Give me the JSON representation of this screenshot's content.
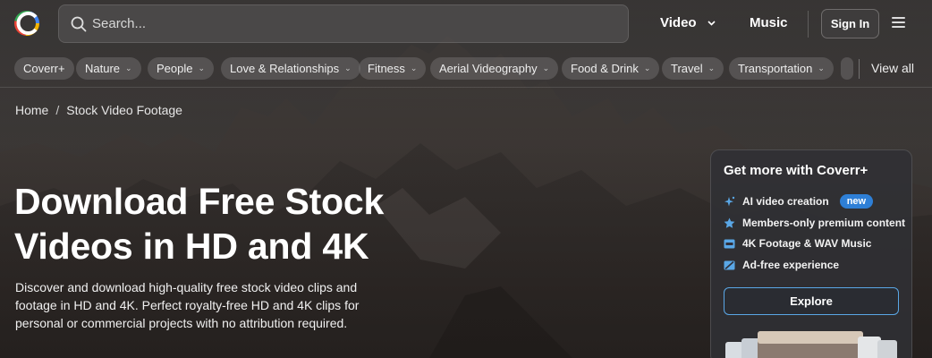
{
  "header": {
    "search_placeholder": "Search...",
    "nav_video": "Video",
    "nav_music": "Music",
    "signin": "Sign In"
  },
  "categories": [
    {
      "label": "Coverr+",
      "has_dropdown": false
    },
    {
      "label": "Nature",
      "has_dropdown": true
    },
    {
      "label": "People",
      "has_dropdown": true
    },
    {
      "label": "Love & Relationships",
      "has_dropdown": true
    },
    {
      "label": "Fitness",
      "has_dropdown": true
    },
    {
      "label": "Aerial Videography",
      "has_dropdown": true
    },
    {
      "label": "Food & Drink",
      "has_dropdown": true
    },
    {
      "label": "Travel",
      "has_dropdown": true
    },
    {
      "label": "Transportation",
      "has_dropdown": true
    }
  ],
  "view_all": "View all",
  "breadcrumb": {
    "home": "Home",
    "separator": "/",
    "current": "Stock Video Footage"
  },
  "hero": {
    "title_line1": "Download Free Stock",
    "title_line2": "Videos in HD and 4K",
    "description": "Discover and download high-quality free stock video clips and footage in HD and 4K. Perfect royalty-free HD and 4K clips for personal or commercial projects with no attribution required."
  },
  "promo_card": {
    "title": "Get more with Coverr+",
    "features": [
      {
        "label": "AI video creation",
        "icon": "sparkle-icon",
        "badge": "new"
      },
      {
        "label": "Members-only premium content",
        "icon": "star-badge-icon"
      },
      {
        "label": "4K Footage & WAV Music",
        "icon": "4k-icon"
      },
      {
        "label": "Ad-free experience",
        "icon": "no-ads-icon"
      }
    ],
    "button": "Explore"
  },
  "colors": {
    "accent_blue": "#2e7fd6",
    "button_border": "#5aa7e6"
  }
}
